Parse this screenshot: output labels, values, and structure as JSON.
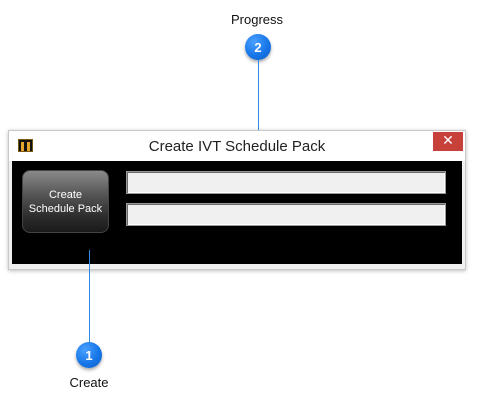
{
  "annotations": {
    "progress": {
      "number": "2",
      "label": "Progress"
    },
    "create": {
      "number": "1",
      "label": "Create"
    }
  },
  "window": {
    "title": "Create IVT Schedule Pack",
    "close_glyph": "✕",
    "app_icon": "pause-bars-icon",
    "create_button_label": "Create Schedule Pack",
    "progress_bars": [
      {
        "value": 0
      },
      {
        "value": 0
      }
    ]
  },
  "colors": {
    "callout": "#1776e8",
    "close": "#c7403a",
    "client_bg": "#000000",
    "icon_accent": "#e6a52a"
  }
}
